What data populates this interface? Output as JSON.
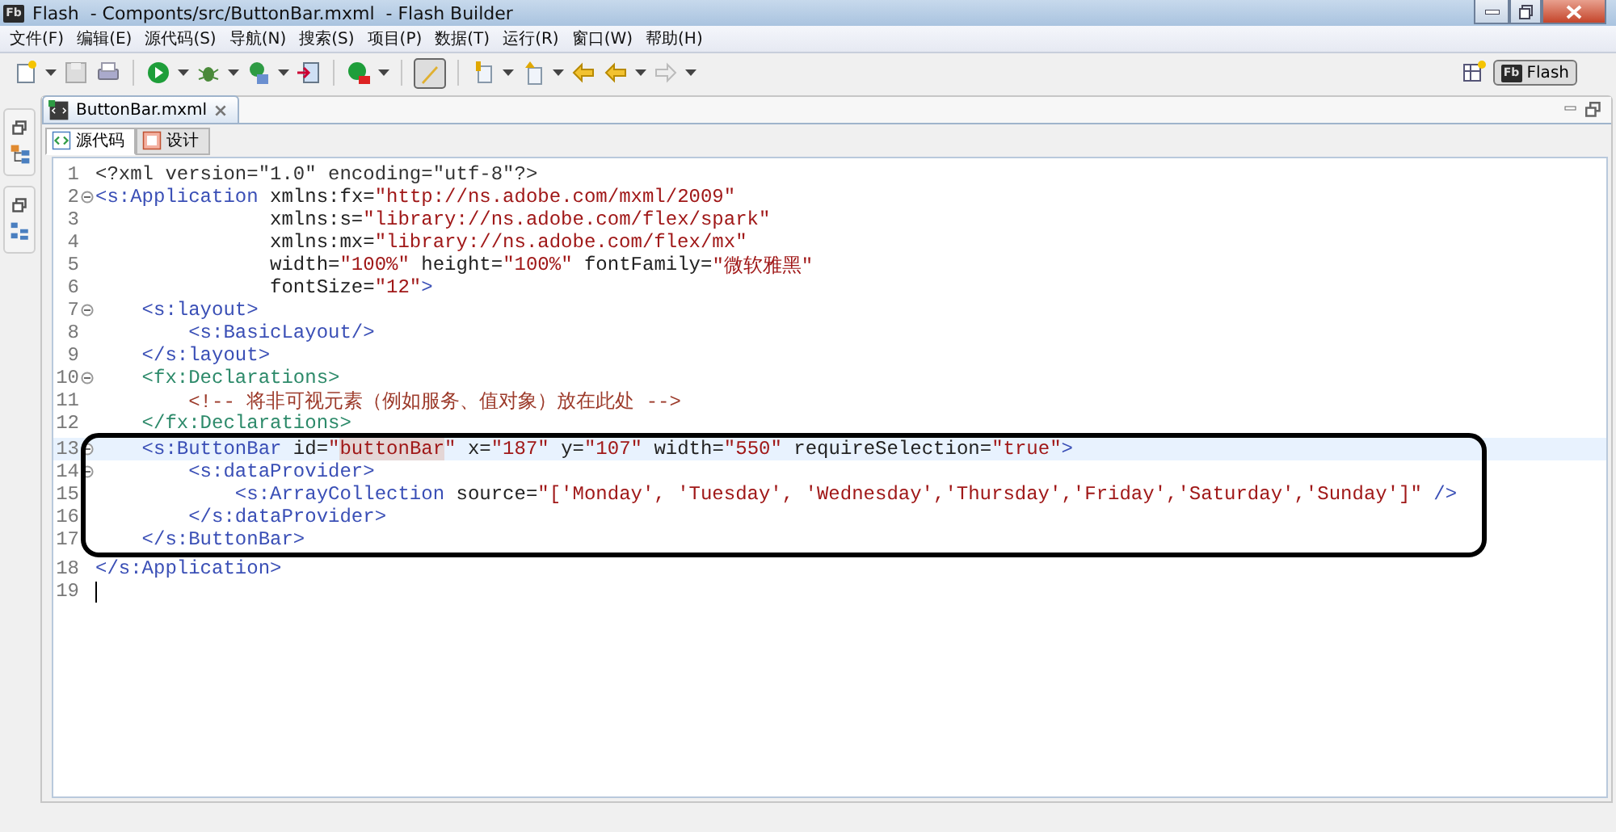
{
  "window": {
    "app_badge": "Fb",
    "title": "Flash  - Componts/src/ButtonBar.mxml  - Flash Builder"
  },
  "menu": [
    "文件(F)",
    "编辑(E)",
    "源代码(S)",
    "导航(N)",
    "搜索(S)",
    "项目(P)",
    "数据(T)",
    "运行(R)",
    "窗口(W)",
    "帮助(H)"
  ],
  "perspective": {
    "badge": "Fb",
    "label": "Flash",
    "selected": true
  },
  "editor_tab": {
    "label": "ButtonBar.mxml",
    "selected": true
  },
  "mode_tabs": [
    {
      "label": "源代码",
      "selected": true
    },
    {
      "label": "设计",
      "selected": false
    }
  ],
  "code_blocks": [
    {
      "kind": "plain",
      "lines": [
        {
          "n": "1",
          "kind": "normal",
          "fold": false,
          "tokens": [
            {
              "kind": "pi",
              "t": "<?xml version=\"1.0\" encoding=\"utf-8\"?>"
            }
          ]
        },
        {
          "n": "2",
          "kind": "normal",
          "fold": true,
          "tokens": [
            {
              "kind": "tag",
              "t": "<s:Application"
            },
            {
              "kind": "attr",
              "t": " xmlns:fx="
            },
            {
              "kind": "value",
              "t": "\"http://ns.adobe.com/mxml/2009\""
            }
          ]
        },
        {
          "n": "3",
          "kind": "normal",
          "fold": false,
          "tokens": [
            {
              "kind": "attr",
              "t": "               xmlns:s="
            },
            {
              "kind": "value",
              "t": "\"library://ns.adobe.com/flex/spark\""
            }
          ]
        },
        {
          "n": "4",
          "kind": "normal",
          "fold": false,
          "tokens": [
            {
              "kind": "attr",
              "t": "               xmlns:mx="
            },
            {
              "kind": "value",
              "t": "\"library://ns.adobe.com/flex/mx\""
            }
          ]
        },
        {
          "n": "5",
          "kind": "normal",
          "fold": false,
          "tokens": [
            {
              "kind": "attr",
              "t": "               width="
            },
            {
              "kind": "value",
              "t": "\"100%\""
            },
            {
              "kind": "attr",
              "t": " height="
            },
            {
              "kind": "value",
              "t": "\"100%\""
            },
            {
              "kind": "attr",
              "t": " fontFamily="
            },
            {
              "kind": "value",
              "t": "\"微软雅黑\""
            }
          ]
        },
        {
          "n": "6",
          "kind": "normal",
          "fold": false,
          "tokens": [
            {
              "kind": "attr",
              "t": "               fontSize="
            },
            {
              "kind": "value",
              "t": "\"12\""
            },
            {
              "kind": "tag",
              "t": ">"
            }
          ]
        },
        {
          "n": "7",
          "kind": "normal",
          "fold": true,
          "tokens": [
            {
              "kind": "tag",
              "t": "    <s:layout>"
            }
          ]
        },
        {
          "n": "8",
          "kind": "normal",
          "fold": false,
          "tokens": [
            {
              "kind": "tag",
              "t": "        <s:BasicLayout/>"
            }
          ]
        },
        {
          "n": "9",
          "kind": "normal",
          "fold": false,
          "tokens": [
            {
              "kind": "tag",
              "t": "    </s:layout>"
            }
          ]
        },
        {
          "n": "10",
          "kind": "normal",
          "fold": true,
          "tokens": [
            {
              "kind": "fxtag",
              "t": "    <fx:Declarations>"
            }
          ]
        },
        {
          "n": "11",
          "kind": "normal",
          "fold": false,
          "tokens": [
            {
              "kind": "comment",
              "t": "        <!-- 将非可视元素（例如服务、值对象）放在此处 -->"
            }
          ]
        },
        {
          "n": "12",
          "kind": "normal",
          "fold": false,
          "tokens": [
            {
              "kind": "fxtag",
              "t": "    </fx:Declarations>"
            }
          ]
        }
      ]
    },
    {
      "kind": "circled",
      "lines": [
        {
          "n": "13",
          "kind": "current",
          "fold": true,
          "tokens": [
            {
              "kind": "tag",
              "t": "    <s:ButtonBar"
            },
            {
              "kind": "attr",
              "t": " id="
            },
            {
              "kind": "value",
              "t": "\""
            },
            {
              "kind": "occurrence",
              "t": "buttonBar"
            },
            {
              "kind": "value",
              "t": "\""
            },
            {
              "kind": "attr",
              "t": " x="
            },
            {
              "kind": "value",
              "t": "\"187\""
            },
            {
              "kind": "attr",
              "t": " y="
            },
            {
              "kind": "value",
              "t": "\"107\""
            },
            {
              "kind": "attr",
              "t": " width="
            },
            {
              "kind": "value",
              "t": "\"550\""
            },
            {
              "kind": "attr",
              "t": " requireSelection="
            },
            {
              "kind": "value",
              "t": "\"true\""
            },
            {
              "kind": "tag",
              "t": ">"
            }
          ]
        },
        {
          "n": "14",
          "kind": "normal",
          "fold": true,
          "tokens": [
            {
              "kind": "tag",
              "t": "        <s:dataProvider>"
            }
          ]
        },
        {
          "n": "15",
          "kind": "normal",
          "fold": false,
          "tokens": [
            {
              "kind": "tag",
              "t": "            <s:ArrayCollection"
            },
            {
              "kind": "attr",
              "t": " source="
            },
            {
              "kind": "value",
              "t": "\"['Monday', 'Tuesday', 'Wednesday','Thursday','Friday','Saturday','Sunday']\""
            },
            {
              "kind": "tag",
              "t": " />"
            }
          ]
        },
        {
          "n": "16",
          "kind": "normal",
          "fold": false,
          "tokens": [
            {
              "kind": "tag",
              "t": "        </s:dataProvider>"
            }
          ]
        },
        {
          "n": "17",
          "kind": "normal",
          "fold": false,
          "tokens": [
            {
              "kind": "tag",
              "t": "    </s:ButtonBar>"
            }
          ]
        }
      ]
    },
    {
      "kind": "plain",
      "lines": [
        {
          "n": "18",
          "kind": "normal",
          "fold": false,
          "tokens": [
            {
              "kind": "tag",
              "t": "</s:Application>"
            }
          ]
        },
        {
          "n": "19",
          "kind": "normal",
          "fold": false,
          "tokens": [
            {
              "kind": "caret"
            }
          ]
        }
      ]
    }
  ]
}
